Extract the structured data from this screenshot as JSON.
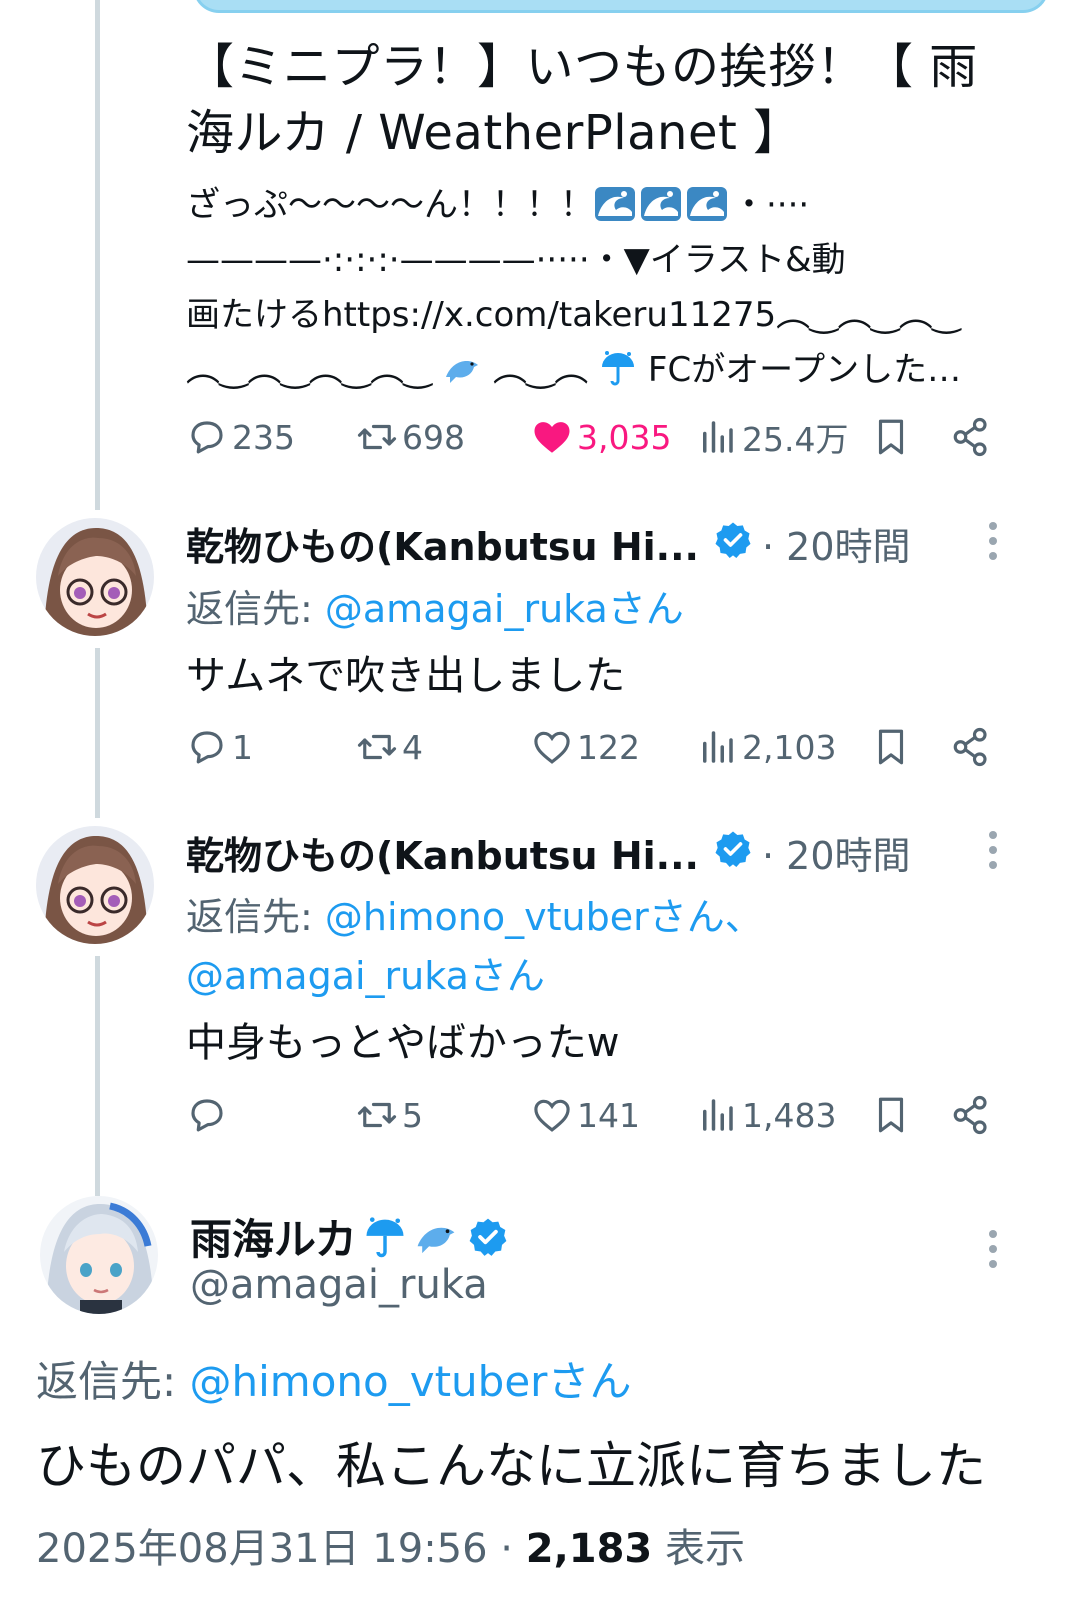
{
  "quoted_post": {
    "title": "【ミニプラ！】いつもの挨拶！【 雨海ルカ / WeatherPlanet 】",
    "title_line1": "【ミニプラ！】いつもの挨拶！【 雨",
    "title_line2": "海ルカ / WeatherPlanet 】",
    "body_line1_text": "ざっぷ〜〜〜〜ん！！！！",
    "body_line1_tail": "・····",
    "body_line2": "————·:·:·:·————·····・▼イラスト&動",
    "body_line3": "画たけるhttps://x.com/takeru11275︵‿︵‿︵‿",
    "body_line4_a": "︵‿︵‿︵‿︵‿",
    "body_line4_b": "︵‿︵",
    "body_line4_c": "FCがオープンした…",
    "wave_icon": "water-wave-emoji",
    "replies": "235",
    "reposts": "698",
    "likes": "3,035",
    "views": "25.4万",
    "liked": true,
    "like_color": "#f91880"
  },
  "reply1": {
    "name": "乾物ひもの(Kanbutsu Hi...",
    "time": "· 20時間",
    "reply_to_label": "返信先: ",
    "reply_to_handle": "@amagai_rukaさん",
    "text": "サムネで吹き出しました",
    "replies": "1",
    "reposts": "4",
    "likes": "122",
    "views": "2,103"
  },
  "reply2": {
    "name": "乾物ひもの(Kanbutsu Hi...",
    "time": "· 20時間",
    "reply_to_label": "返信先: ",
    "reply_to_handle1": "@himono_vtuberさん、",
    "reply_to_handle2": "@amagai_rukaさん",
    "text": "中身もっとやばかったw",
    "replies": "",
    "reposts": "5",
    "likes": "141",
    "views": "1,483"
  },
  "main_post": {
    "name": "雨海ルカ",
    "name_emojis": [
      "umbrella-icon",
      "dolphin-icon"
    ],
    "handle": "@amagai_ruka",
    "reply_to_label": "返信先: ",
    "reply_to_handle": "@himono_vtuberさん",
    "text": "ひものパパ、私こんなに立派に育ちました",
    "date": "2025年08月31日 19:56 · ",
    "views_count": "2,183",
    "views_label": " 表示"
  },
  "colors": {
    "text": "#0f1419",
    "secondary": "#536471",
    "link": "#1d9bf0",
    "verified": "#1d9bf0",
    "like": "#f91880",
    "thread_line": "#cfd9de"
  }
}
